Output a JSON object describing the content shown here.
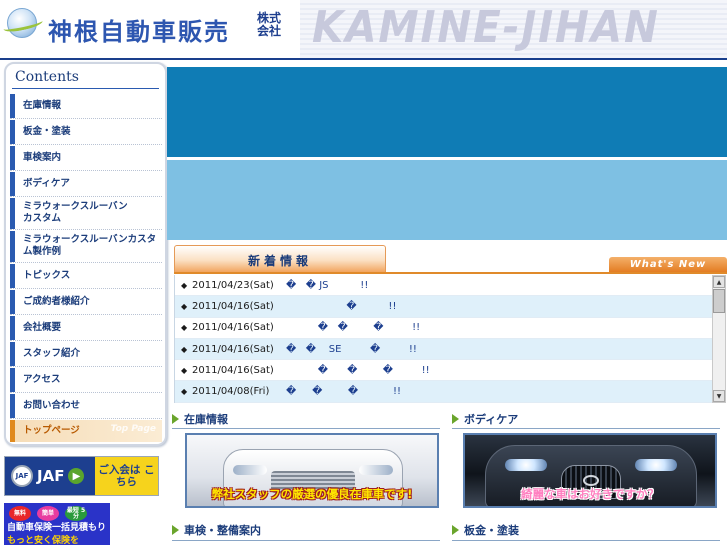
{
  "header": {
    "company_name": "神根自動車販売",
    "company_suffix": "株式会社",
    "brand": "KAMINE-JIHAN"
  },
  "nav": {
    "title": "Contents",
    "items": [
      {
        "label": "在庫情報"
      },
      {
        "label": "板金・塗装"
      },
      {
        "label": "車検案内"
      },
      {
        "label": "ボディケア"
      },
      {
        "label": "ミラウォークスルーバンカスタム"
      },
      {
        "label": "ミラウォークスルーバンカスタム製作例"
      },
      {
        "label": "トピックス"
      },
      {
        "label": "ご成約者様紹介"
      },
      {
        "label": "会社概要"
      },
      {
        "label": "スタッフ紹介"
      },
      {
        "label": "アクセス"
      },
      {
        "label": "お問い合わせ"
      }
    ],
    "toppage": {
      "label": "トップページ",
      "label_en": "Top Page"
    }
  },
  "banners": {
    "jaf": {
      "logo": "JAF",
      "text": "JAF",
      "cta": "ご入会は こちら"
    },
    "insurance": {
      "badges": [
        "無料",
        "簡単",
        "最短 5分"
      ],
      "text": "自動車保険一括見積もり",
      "text2": "もっと安く保険を"
    }
  },
  "news": {
    "tab_label": "新着情報",
    "whats_new": "What's New",
    "items": [
      {
        "date": "2011/04/23(Sat)",
        "title": "�   � JS          !!"
      },
      {
        "date": "2011/04/16(Sat)",
        "title": "                   �          !!"
      },
      {
        "date": "2011/04/16(Sat)",
        "title": "          �   �        �         !!"
      },
      {
        "date": "2011/04/16(Sat)",
        "title": "�   �    SE         �         !!"
      },
      {
        "date": "2011/04/16(Sat)",
        "title": "          �      �        �         !!"
      },
      {
        "date": "2011/04/08(Fri)",
        "title": "�     �        �           !!"
      }
    ]
  },
  "sections": {
    "stock": {
      "label": "在庫情報",
      "caption": "弊社スタッフの厳選の優良在庫車です!"
    },
    "bodycare": {
      "label": "ボディケア",
      "caption": "綺麗な車はお好きですか？"
    },
    "inspection": {
      "label": "車検・整備案内"
    },
    "sheetmetal": {
      "label": "板金・塗装"
    }
  },
  "icons": {
    "section_arrow": "triangle-right-icon",
    "news_bullet": "diamond-icon",
    "jaf_arrow": "arrow-right-icon",
    "scroll_up": "scroll-up-icon",
    "scroll_down": "scroll-down-icon"
  },
  "colors": {
    "brand_blue": "#2d56b0",
    "hero_dark": "#0f7cb5",
    "hero_light": "#7ec0e3",
    "accent_orange": "#e08a2a",
    "accent_green": "#6aa52c"
  }
}
